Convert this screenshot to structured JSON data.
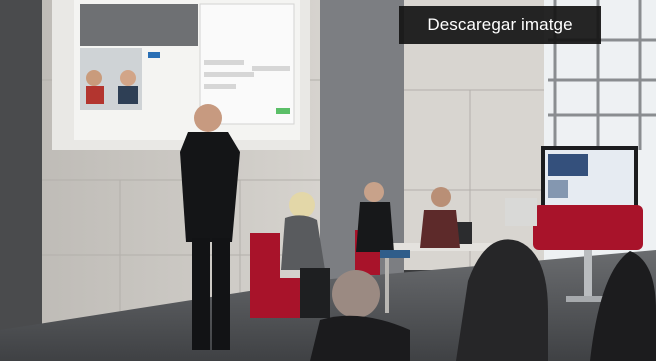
{
  "viewer": {
    "download_label": "Descaregar imatge"
  },
  "photo": {
    "icon": "photo-of-sign-language-interpretation-panel",
    "colors": {
      "wall": "#c9c6c1",
      "projection": "#f1f1ef",
      "chair": "#a8132a",
      "floor": "#5b5d60"
    }
  }
}
